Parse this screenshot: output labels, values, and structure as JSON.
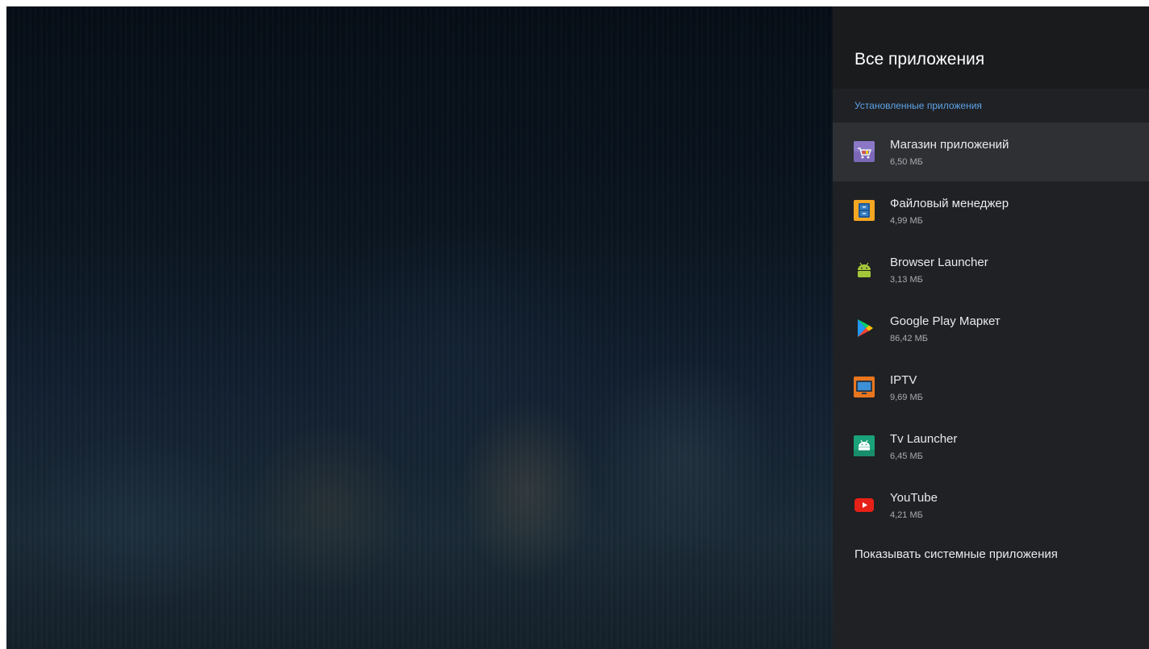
{
  "panel": {
    "title": "Все приложения",
    "section_label": "Установленные приложения",
    "show_system_label": "Показывать системные приложения"
  },
  "apps": [
    {
      "name": "Магазин приложений",
      "size": "6,50 МБ",
      "icon": "app-store-cart-icon",
      "focused": true
    },
    {
      "name": "Файловый менеджер",
      "size": "4,99 МБ",
      "icon": "file-manager-icon",
      "focused": false
    },
    {
      "name": "Browser Launcher",
      "size": "3,13 МБ",
      "icon": "android-robot-icon",
      "focused": false
    },
    {
      "name": "Google Play Маркет",
      "size": "86,42 МБ",
      "icon": "google-play-icon",
      "focused": false
    },
    {
      "name": "IPTV",
      "size": "9,69 МБ",
      "icon": "iptv-tv-icon",
      "focused": false
    },
    {
      "name": "Tv Launcher",
      "size": "6,45 МБ",
      "icon": "tv-launcher-icon",
      "focused": false
    },
    {
      "name": "YouTube",
      "size": "4,21 МБ",
      "icon": "youtube-icon",
      "focused": false
    }
  ],
  "colors": {
    "panel_background": "#202124",
    "header_background": "#1a1b1d",
    "focused_row": "#2e3033",
    "section_accent": "#5ea4e8"
  }
}
